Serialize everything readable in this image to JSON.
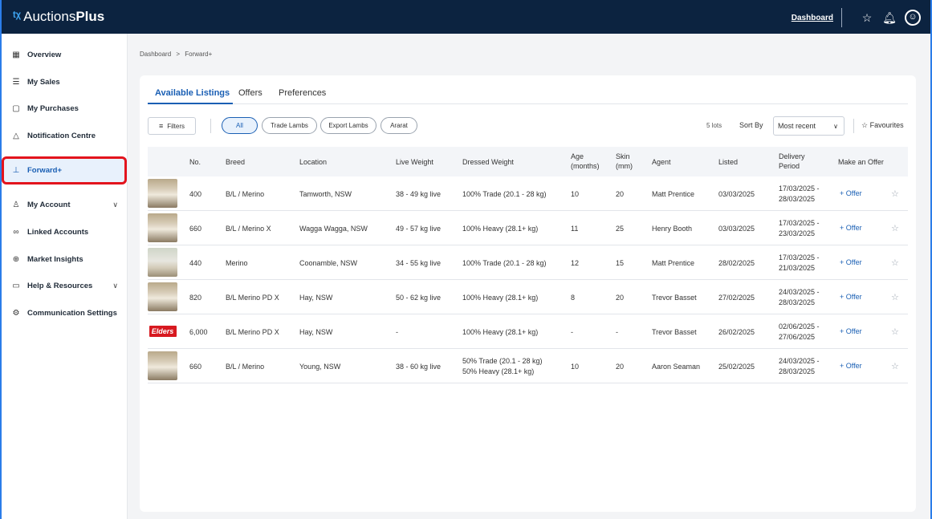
{
  "app": {
    "logo_prefix": "Auctions",
    "logo_bold": "Plus"
  },
  "topbar": {
    "dashboard_link": "Dashboard",
    "icons": [
      "star-icon",
      "bell-icon",
      "user-icon"
    ]
  },
  "sidebar": {
    "items": [
      {
        "label": "Overview",
        "icon": "grid-icon"
      },
      {
        "label": "My Sales",
        "icon": "list-icon"
      },
      {
        "label": "My Purchases",
        "icon": "bag-icon"
      },
      {
        "label": "Notification Centre",
        "icon": "bell-icon"
      },
      {
        "label": "Forward+",
        "icon": "pin-icon",
        "active": true
      },
      {
        "label": "My Account",
        "icon": "person-icon",
        "expandable": true
      },
      {
        "label": "Linked Accounts",
        "icon": "link-icon"
      },
      {
        "label": "Market Insights",
        "icon": "search-chart-icon"
      },
      {
        "label": "Help & Resources",
        "icon": "book-icon",
        "expandable": true
      },
      {
        "label": "Communication Settings",
        "icon": "gear-icon"
      }
    ],
    "collapse_glyph": "«"
  },
  "breadcrumb": {
    "home": "Dashboard",
    "sep": ">",
    "current": "Forward+"
  },
  "tabs": [
    "Available Listings",
    "Offers",
    "Preferences"
  ],
  "filters": {
    "button_label": "Filters",
    "chips": [
      "All",
      "Trade Lambs",
      "Export Lambs",
      "Ararat"
    ],
    "lots": "5 lots",
    "sort_label": "Sort By",
    "sort_value": "Most recent",
    "favourites_label": "Favourites"
  },
  "table": {
    "headers": [
      "No.",
      "Breed",
      "Location",
      "Live Weight",
      "Dressed Weight",
      "Age\n(months)",
      "Skin\n(mm)",
      "Agent",
      "Listed",
      "Delivery\nPeriod",
      "Make an Offer"
    ],
    "offer_label": "+ Offer",
    "rows": [
      {
        "no": "400",
        "breed": "B/L / Merino",
        "location": "Tamworth, NSW",
        "live": "38 - 49 kg live",
        "dressed": [
          "100% Trade (20.1 - 28 kg)"
        ],
        "age": "10",
        "skin": "20",
        "agent": "Matt Prentice",
        "listed": "03/03/2025",
        "delivery": [
          "17/03/2025 -",
          "28/03/2025"
        ],
        "thumb": "sheep"
      },
      {
        "no": "660",
        "breed": "B/L / Merino X",
        "location": "Wagga Wagga, NSW",
        "live": "49 - 57 kg live",
        "dressed": [
          "100% Heavy (28.1+ kg)"
        ],
        "age": "11",
        "skin": "25",
        "agent": "Henry Booth",
        "listed": "03/03/2025",
        "delivery": [
          "17/03/2025 -",
          "23/03/2025"
        ],
        "thumb": "sheep"
      },
      {
        "no": "440",
        "breed": "Merino",
        "location": "Coonamble, NSW",
        "live": "34 - 55 kg live",
        "dressed": [
          "100% Trade (20.1 - 28 kg)"
        ],
        "age": "12",
        "skin": "15",
        "agent": "Matt Prentice",
        "listed": "28/02/2025",
        "delivery": [
          "17/03/2025 -",
          "21/03/2025"
        ],
        "thumb": "sheep2"
      },
      {
        "no": "820",
        "breed": "B/L Merino PD X",
        "location": "Hay, NSW",
        "live": "50 - 62 kg live",
        "dressed": [
          "100% Heavy (28.1+ kg)"
        ],
        "age": "8",
        "skin": "20",
        "agent": "Trevor Basset",
        "listed": "27/02/2025",
        "delivery": [
          "24/03/2025 -",
          "28/03/2025"
        ],
        "thumb": "sheep"
      },
      {
        "no": "6,000",
        "breed": "B/L Merino PD X",
        "location": "Hay, NSW",
        "live": "-",
        "dressed": [
          "100% Heavy (28.1+ kg)"
        ],
        "age": "-",
        "skin": "-",
        "agent": "Trevor Basset",
        "listed": "26/02/2025",
        "delivery": [
          "02/06/2025 -",
          "27/06/2025"
        ],
        "thumb": "elders",
        "thumb_text": "Elders"
      },
      {
        "no": "660",
        "breed": "B/L / Merino",
        "location": "Young, NSW",
        "live": "38 - 60 kg live",
        "dressed": [
          "50% Trade (20.1 - 28 kg)",
          "50% Heavy (28.1+ kg)"
        ],
        "age": "10",
        "skin": "20",
        "agent": "Aaron Seaman",
        "listed": "25/02/2025",
        "delivery": [
          "24/03/2025 -",
          "28/03/2025"
        ],
        "thumb": "sheep"
      }
    ]
  },
  "colors": {
    "topbar": "#0c2340",
    "accent": "#1a5fb4",
    "highlight": "#e3141d"
  }
}
